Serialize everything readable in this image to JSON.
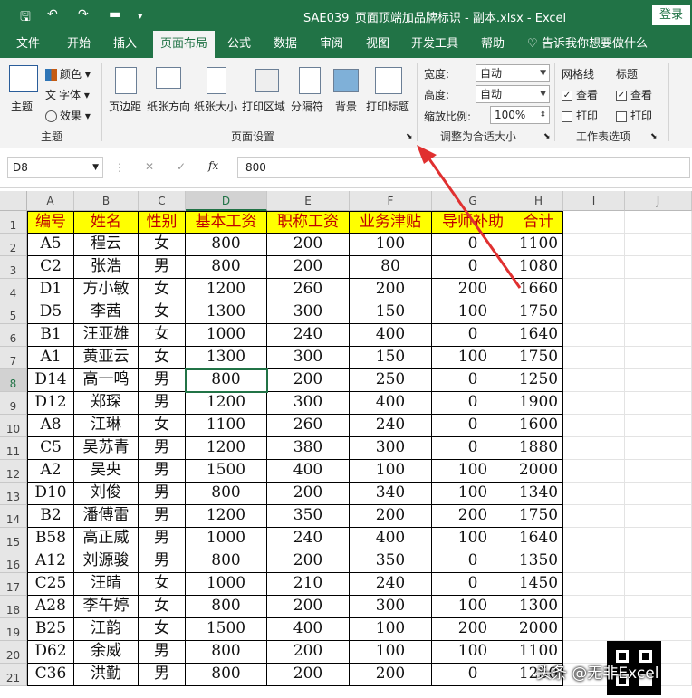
{
  "window": {
    "title": "SAE039_页面顶端加品牌标识 - 副本.xlsx  -  Excel",
    "login_label": "登录"
  },
  "quick_access": [
    "save-icon",
    "undo-icon",
    "redo-icon",
    "open-folder-icon",
    "customize-icon"
  ],
  "tabs": [
    "文件",
    "开始",
    "插入",
    "页面布局",
    "公式",
    "数据",
    "审阅",
    "视图",
    "开发工具",
    "帮助",
    "告诉我你想要做什么"
  ],
  "active_tab": "页面布局",
  "ribbon": {
    "theme_group": {
      "label": "主题",
      "theme_btn": "主题",
      "colors": "颜色",
      "fonts": "字体",
      "effects": "效果"
    },
    "page_setup": {
      "label": "页面设置",
      "margins": "页边距",
      "orientation": "纸张方向",
      "size": "纸张大小",
      "print_area": "打印区域",
      "breaks": "分隔符",
      "background": "背景",
      "print_titles": "打印标题"
    },
    "scale_fit": {
      "label": "调整为合适大小",
      "width_label": "宽度:",
      "width_value": "自动",
      "height_label": "高度:",
      "height_value": "自动",
      "scale_label": "缩放比例:",
      "scale_value": "100%"
    },
    "sheet_options": {
      "label": "工作表选项",
      "gridlines": "网格线",
      "headings": "标题",
      "view": "查看",
      "print": "打印"
    }
  },
  "formula_bar": {
    "name_box": "D8",
    "content": "800",
    "fx": "fx"
  },
  "grid": {
    "columns": [
      "A",
      "B",
      "C",
      "D",
      "E",
      "F",
      "G",
      "H",
      "I",
      "J"
    ],
    "selected_column": "D",
    "selected_row": "8",
    "header_row": [
      "编号",
      "姓名",
      "性别",
      "基本工资",
      "职称工资",
      "业务津贴",
      "导师补助",
      "合计"
    ],
    "rows": [
      [
        "A5",
        "程云",
        "女",
        "800",
        "200",
        "100",
        "0",
        "1100"
      ],
      [
        "C2",
        "张浩",
        "男",
        "800",
        "200",
        "80",
        "0",
        "1080"
      ],
      [
        "D1",
        "方小敏",
        "女",
        "1200",
        "260",
        "200",
        "200",
        "1660"
      ],
      [
        "D5",
        "李茜",
        "女",
        "1300",
        "300",
        "150",
        "100",
        "1750"
      ],
      [
        "B1",
        "汪亚雄",
        "女",
        "1000",
        "240",
        "400",
        "0",
        "1640"
      ],
      [
        "A1",
        "黄亚云",
        "女",
        "1300",
        "300",
        "150",
        "100",
        "1750"
      ],
      [
        "D14",
        "高一鸣",
        "男",
        "800",
        "200",
        "250",
        "0",
        "1250"
      ],
      [
        "D12",
        "郑琛",
        "男",
        "1200",
        "300",
        "400",
        "0",
        "1900"
      ],
      [
        "A8",
        "江琳",
        "女",
        "1100",
        "260",
        "240",
        "0",
        "1600"
      ],
      [
        "C5",
        "吴苏青",
        "男",
        "1200",
        "380",
        "300",
        "0",
        "1880"
      ],
      [
        "A2",
        "吴央",
        "男",
        "1500",
        "400",
        "100",
        "100",
        "2000"
      ],
      [
        "D10",
        "刘俊",
        "男",
        "800",
        "200",
        "340",
        "100",
        "1340"
      ],
      [
        "B2",
        "潘傅雷",
        "男",
        "1200",
        "350",
        "200",
        "200",
        "1750"
      ],
      [
        "B58",
        "高正威",
        "男",
        "1000",
        "240",
        "400",
        "100",
        "1640"
      ],
      [
        "A12",
        "刘源骏",
        "男",
        "800",
        "200",
        "350",
        "0",
        "1350"
      ],
      [
        "C25",
        "汪晴",
        "女",
        "1000",
        "210",
        "240",
        "0",
        "1450"
      ],
      [
        "A28",
        "李午婷",
        "女",
        "800",
        "200",
        "300",
        "100",
        "1300"
      ],
      [
        "B25",
        "江韵",
        "女",
        "1500",
        "400",
        "100",
        "200",
        "2000"
      ],
      [
        "D62",
        "余威",
        "男",
        "800",
        "200",
        "100",
        "100",
        "1100"
      ],
      [
        "C36",
        "洪勤",
        "男",
        "800",
        "200",
        "200",
        "0",
        "1250"
      ]
    ]
  },
  "watermark": "头条 @无非Excel",
  "colors": {
    "excel_green": "#217346",
    "header_fill": "#ffff00",
    "header_text": "#c00000",
    "arrow": "#e03030"
  }
}
